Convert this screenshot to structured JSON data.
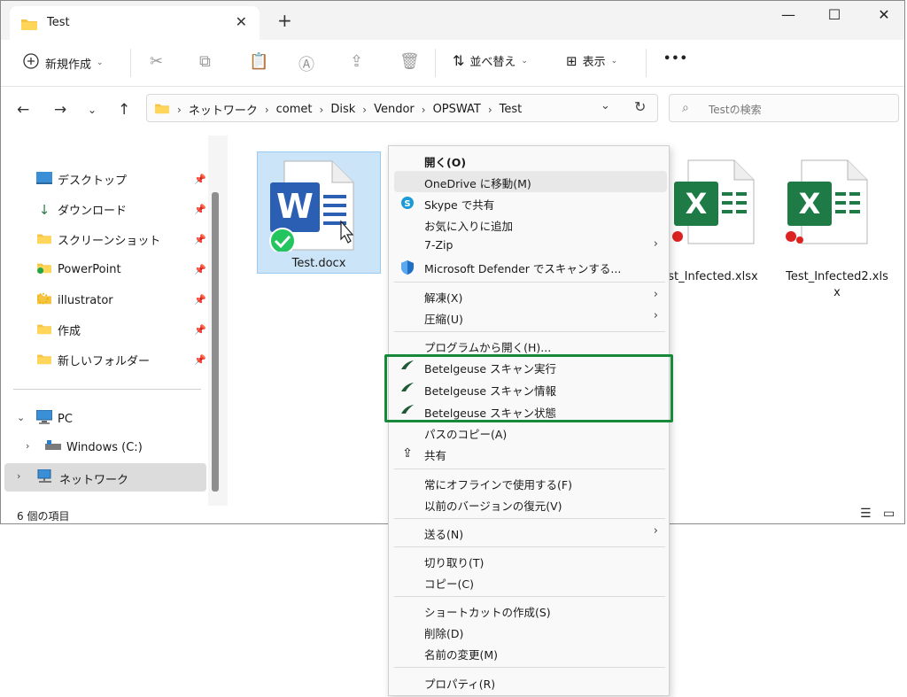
{
  "tab": {
    "title": "Test"
  },
  "window_controls": {
    "minimize": "—",
    "maximize": "☐",
    "close": "✕",
    "new_tab": "+"
  },
  "toolbar": {
    "new_label": "新規作成",
    "sort_label": "並べ替え",
    "view_label": "表示",
    "more_label": "•••"
  },
  "address": {
    "crumbs": [
      "ネットワーク",
      "comet",
      "Disk",
      "Vendor",
      "OPSWAT",
      "Test"
    ]
  },
  "search": {
    "placeholder": "Testの検索"
  },
  "sidebar": {
    "quick": [
      {
        "label": "デスクトップ",
        "icon": "desktop-icon"
      },
      {
        "label": "ダウンロード",
        "icon": "download-icon"
      },
      {
        "label": "スクリーンショット",
        "icon": "folder-icon"
      },
      {
        "label": "PowerPoint",
        "icon": "folder-icon"
      },
      {
        "label": "illustrator",
        "icon": "folder-icon"
      },
      {
        "label": "作成",
        "icon": "folder-icon"
      },
      {
        "label": "新しいフォルダー",
        "icon": "folder-icon"
      }
    ],
    "pc": "PC",
    "drive": "Windows (C:)",
    "network": "ネットワーク"
  },
  "files": [
    {
      "name": "Test.docx"
    },
    {
      "name": "st_Infected.xlsx"
    },
    {
      "name": "Test_Infected2.xls",
      "name2": "x"
    }
  ],
  "status": {
    "count": "6 個の項目"
  },
  "context_menu": {
    "open": "開く(O)",
    "onedrive": "OneDrive に移動(M)",
    "skype": "Skype で共有",
    "favorite": "お気に入りに追加",
    "zip": "7-Zip",
    "defender": "Microsoft Defender でスキャンする...",
    "extract": "解凍(X)",
    "compress": "圧縮(U)",
    "open_with": "プログラムから開く(H)...",
    "bg_run": "Betelgeuse スキャン実行",
    "bg_info": "Betelgeuse スキャン情報",
    "bg_status": "Betelgeuse スキャン状態",
    "copy_path": "パスのコピー(A)",
    "share": "共有",
    "offline": "常にオフラインで使用する(F)",
    "restore": "以前のバージョンの復元(V)",
    "send_to": "送る(N)",
    "cut": "切り取り(T)",
    "copy": "コピー(C)",
    "shortcut": "ショートカットの作成(S)",
    "delete": "削除(D)",
    "rename": "名前の変更(M)",
    "properties": "プロパティ(R)"
  },
  "colors": {
    "highlight": "#168a3a",
    "word_blue": "#2b5fb4",
    "excel_green": "#1e7b45",
    "check_green": "#22c55e"
  }
}
